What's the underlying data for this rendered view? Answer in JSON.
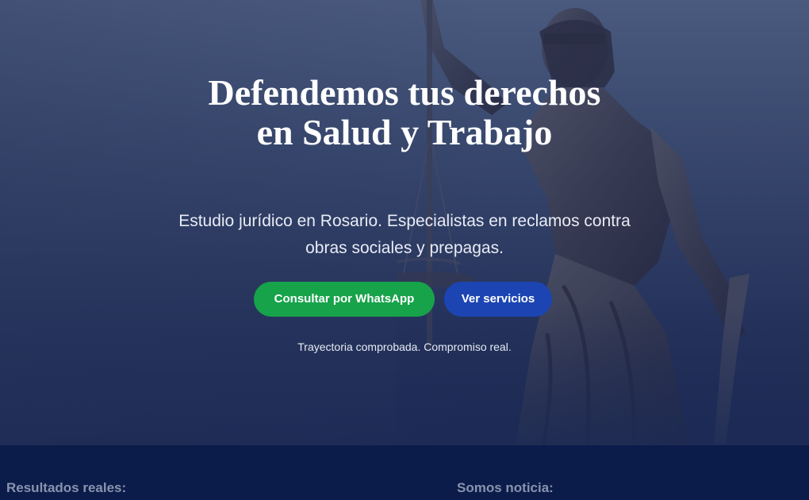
{
  "hero": {
    "title": "Defendemos tus derechos en Salud y Trabajo",
    "subtitle": "Estudio jurídico en Rosario. Especialistas en reclamos contra obras sociales y prepagas.",
    "cta_whatsapp": "Consultar por WhatsApp",
    "cta_services": "Ver servicios",
    "tagline": "Trayectoria comprobada. Compromiso real."
  },
  "sections": {
    "results_heading": "Resultados reales:",
    "news_heading": "Somos noticia:"
  },
  "colors": {
    "whatsapp_green": "#17a34a",
    "primary_blue": "#1c45b3",
    "section_navy": "#0c1c4a",
    "heading_muted": "#8893ad"
  },
  "icons": {
    "background_image": "lady-justice-statue-icon"
  }
}
